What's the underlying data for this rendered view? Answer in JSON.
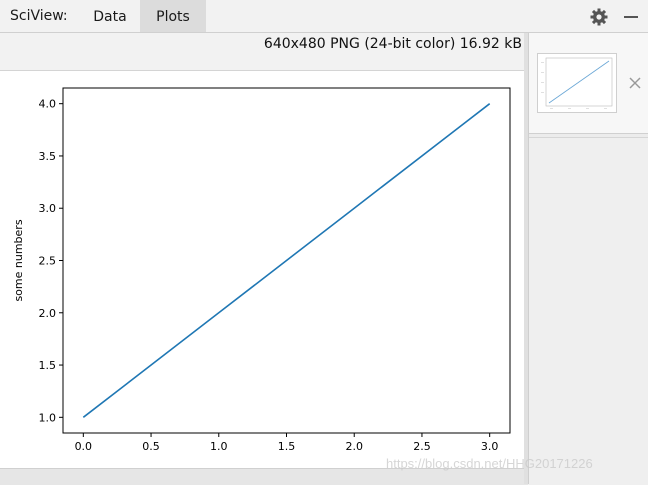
{
  "header": {
    "app_label": "SciView:",
    "tabs": [
      {
        "label": "Data",
        "active": false
      },
      {
        "label": "Plots",
        "active": true
      }
    ],
    "settings_icon": "gear-icon",
    "minimize_icon": "minimize-icon"
  },
  "image_info": "640x480 PNG (24-bit color) 16.92 kB",
  "thumbnail": {
    "close_icon": "close-icon"
  },
  "watermark": "https://blog.csdn.net/HHG20171226",
  "colors": {
    "line": "#1f77b4",
    "active_tab": "#dcdcdc"
  },
  "chart_data": {
    "type": "line",
    "x": [
      0,
      1,
      2,
      3
    ],
    "y": [
      1,
      2,
      3,
      4
    ],
    "ylabel": "some numbers",
    "xlabel": "",
    "title": "",
    "xlim": [
      -0.15,
      3.15
    ],
    "ylim": [
      0.85,
      4.15
    ],
    "xticks": [
      "0.0",
      "0.5",
      "1.0",
      "1.5",
      "2.0",
      "2.5",
      "3.0"
    ],
    "yticks": [
      "1.0",
      "1.5",
      "2.0",
      "2.5",
      "3.0",
      "3.5",
      "4.0"
    ],
    "grid": false
  }
}
